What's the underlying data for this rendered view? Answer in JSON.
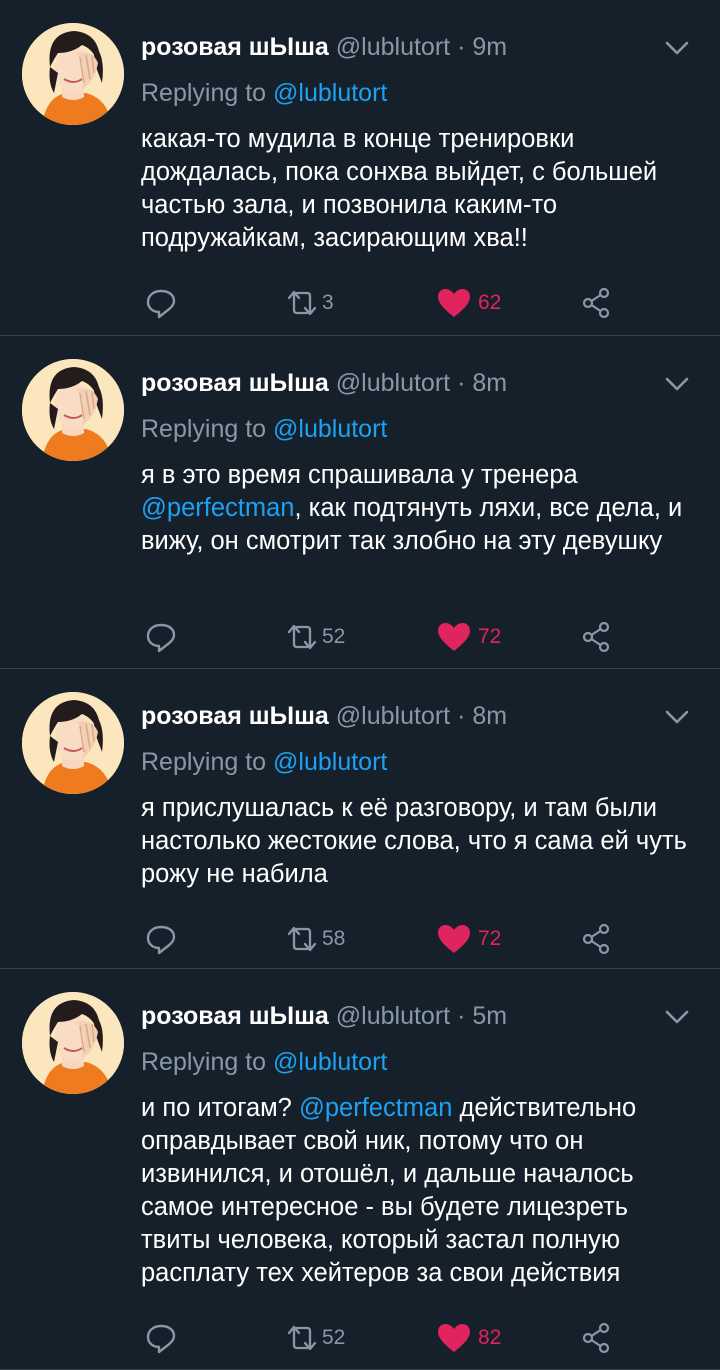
{
  "colors": {
    "background": "#15202b",
    "divider": "#38444d",
    "secondary_text": "#8899a6",
    "link": "#1da1f2",
    "like": "#e0245e"
  },
  "icons": {
    "reply": "reply-icon",
    "retweet": "retweet-icon",
    "like": "heart-icon",
    "share": "share-icon",
    "menu": "chevron-down-icon"
  },
  "tweets": [
    {
      "display_name": "розовая шЫша",
      "handle": "@lublutort",
      "separator": "·",
      "time": "9m",
      "reply_prefix": "Replying to",
      "reply_to": "@lublutort",
      "text_parts": [
        "какая-то мудила в конце тренировки дождалась, пока сонхва выйдет, с большей частью зала, и позвонила каким-то подружайкам, засирающим хва!!"
      ],
      "retweets": "3",
      "likes": "62"
    },
    {
      "display_name": "розовая шЫша",
      "handle": "@lublutort",
      "separator": "·",
      "time": "8m",
      "reply_prefix": "Replying to",
      "reply_to": "@lublutort",
      "text_parts": [
        "я в это время спрашивала у тренера ",
        "@perfectman",
        ", как подтянуть ляхи, все дела, и вижу, он смотрит так злобно на эту девушку"
      ],
      "retweets": "52",
      "likes": "72"
    },
    {
      "display_name": "розовая шЫша",
      "handle": "@lublutort",
      "separator": "·",
      "time": "8m",
      "reply_prefix": "Replying to",
      "reply_to": "@lublutort",
      "text_parts": [
        "я прислушалась к её разговору, и там были настолько жестокие слова, что я сама ей чуть рожу не набила"
      ],
      "retweets": "58",
      "likes": "72"
    },
    {
      "display_name": "розовая шЫша",
      "handle": "@lublutort",
      "separator": "·",
      "time": "5m",
      "reply_prefix": "Replying to",
      "reply_to": "@lublutort",
      "text_parts": [
        "и по итогам? ",
        "@perfectman",
        " действительно оправдывает свой ник, потому что он извинился, и отошёл, и дальше началось самое интересное - вы будете лицезреть твиты человека, который застал полную расплату тех хейтеров  за свои действия"
      ],
      "retweets": "52",
      "likes": "82"
    }
  ]
}
